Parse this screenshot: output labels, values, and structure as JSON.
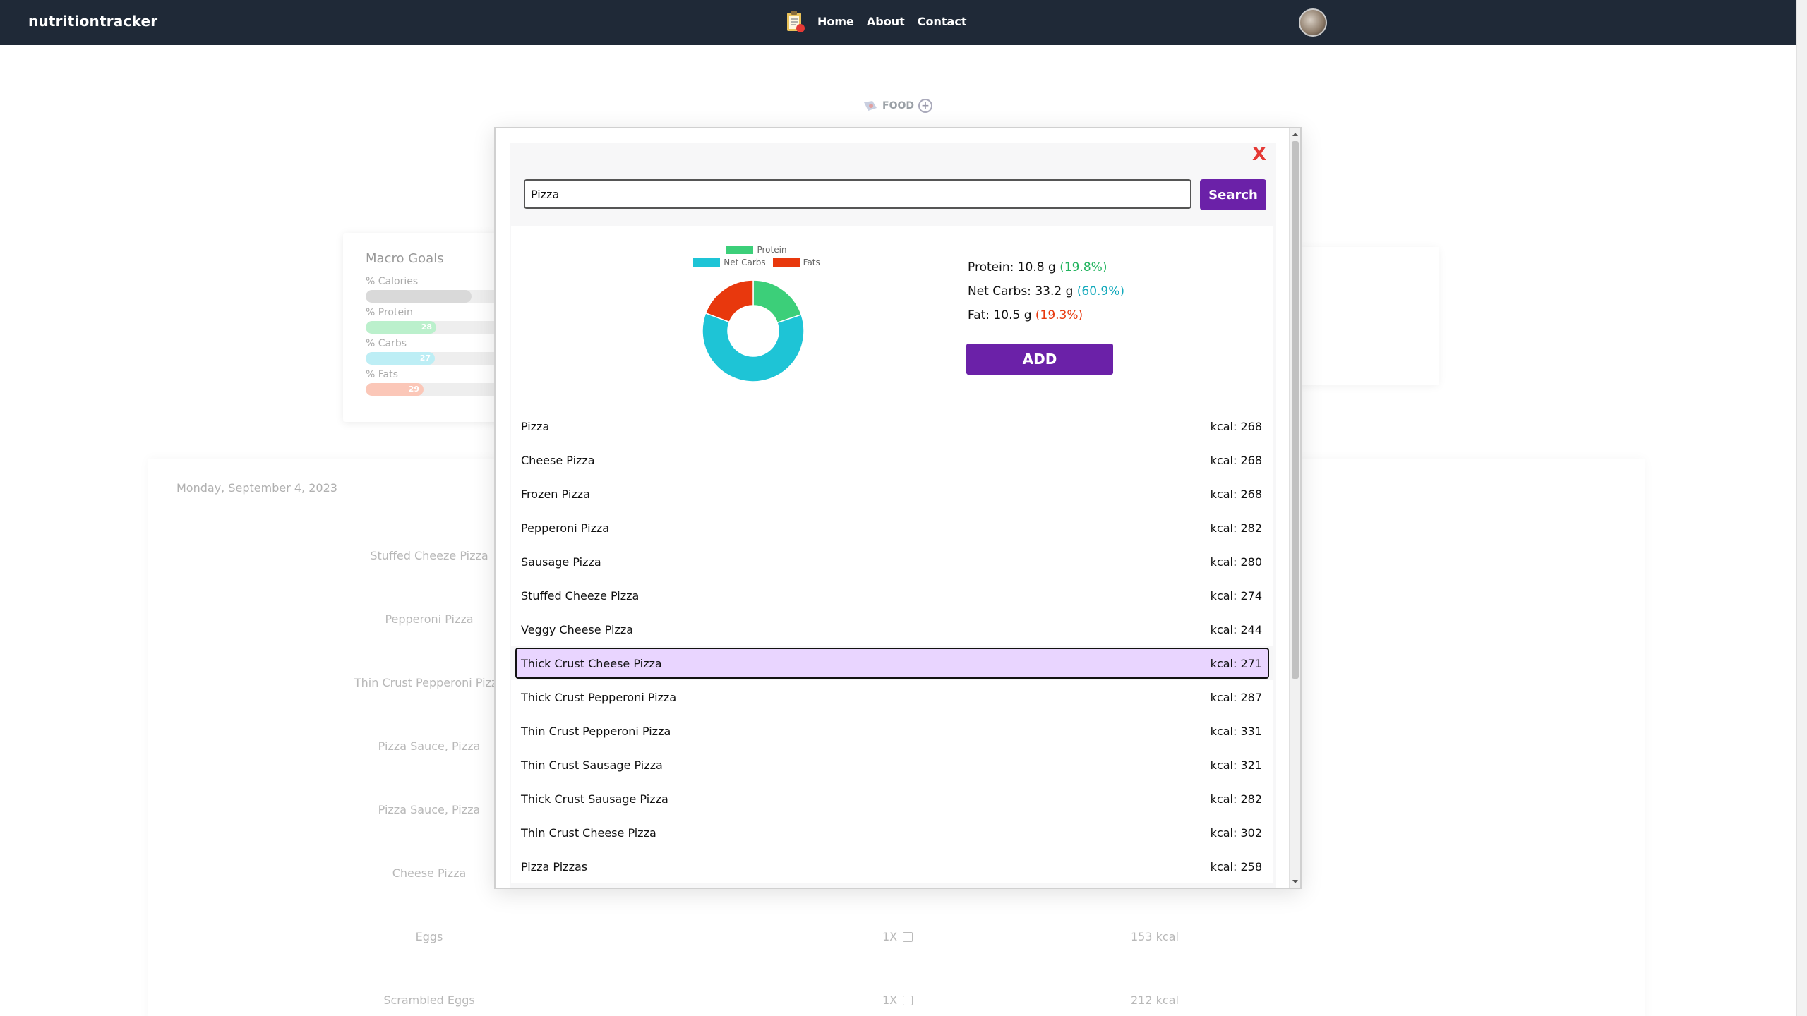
{
  "nav": {
    "brand": "nutritiontracker",
    "links": [
      "Home",
      "About",
      "Contact"
    ]
  },
  "background": {
    "food_header": "FOOD",
    "macro_goals": {
      "title": "Macro Goals",
      "rows": [
        {
          "label": "% Calories",
          "value": "",
          "fill": 0.75,
          "color": "#d9d9d9"
        },
        {
          "label": "% Protein",
          "value": "28",
          "fill": 0.5,
          "color": "#bbf0cc"
        },
        {
          "label": "% Carbs",
          "value": "27",
          "fill": 0.49,
          "color": "#bdeef5"
        },
        {
          "label": "% Fats",
          "value": "29",
          "fill": 0.41,
          "color": "#fbc7b8"
        }
      ]
    },
    "date": "Monday, September 4, 2023",
    "log_items": [
      {
        "name": "Stuffed Cheeze Pizza"
      },
      {
        "name": "Pepperoni Pizza"
      },
      {
        "name": "Thin Crust Pepperoni Pizza"
      },
      {
        "name": "Pizza Sauce, Pizza"
      },
      {
        "name": "Pizza Sauce, Pizza"
      },
      {
        "name": "Cheese Pizza"
      },
      {
        "name": "Eggs",
        "qty": "1X",
        "kcal": "153 kcal"
      },
      {
        "name": "Scrambled Eggs",
        "qty": "1X",
        "kcal": "212 kcal"
      }
    ]
  },
  "modal": {
    "close_label": "X",
    "search": {
      "value": "Pizza",
      "button": "Search"
    },
    "chart_data": {
      "type": "pie",
      "categories": [
        "Protein",
        "Net Carbs",
        "Fats"
      ],
      "values": [
        19.8,
        60.9,
        19.3
      ],
      "colors": [
        "#3ccf79",
        "#1ec4d6",
        "#e8380d"
      ],
      "legend": "top"
    },
    "nutrients": [
      {
        "label": "Protein: ",
        "amount": "10.8 g",
        "pct": "(19.8%)",
        "color": "#22b35e"
      },
      {
        "label": "Net Carbs: ",
        "amount": "33.2 g",
        "pct": "(60.9%)",
        "color": "#12a9bb"
      },
      {
        "label": "Fat: ",
        "amount": "10.5 g",
        "pct": "(19.3%)",
        "color": "#e8380d"
      }
    ],
    "add_label": "ADD",
    "results": [
      {
        "name": "Pizza",
        "kcal": "kcal: 268"
      },
      {
        "name": "Cheese Pizza",
        "kcal": "kcal: 268"
      },
      {
        "name": "Frozen Pizza",
        "kcal": "kcal: 268"
      },
      {
        "name": "Pepperoni Pizza",
        "kcal": "kcal: 282"
      },
      {
        "name": "Sausage Pizza",
        "kcal": "kcal: 280"
      },
      {
        "name": "Stuffed Cheeze Pizza",
        "kcal": "kcal: 274"
      },
      {
        "name": "Veggy Cheese Pizza",
        "kcal": "kcal: 244"
      },
      {
        "name": "Thick Crust Cheese Pizza",
        "kcal": "kcal: 271",
        "selected": true
      },
      {
        "name": "Thick Crust Pepperoni Pizza",
        "kcal": "kcal: 287"
      },
      {
        "name": "Thin Crust Pepperoni Pizza",
        "kcal": "kcal: 331"
      },
      {
        "name": "Thin Crust Sausage Pizza",
        "kcal": "kcal: 321"
      },
      {
        "name": "Thick Crust Sausage Pizza",
        "kcal": "kcal: 282"
      },
      {
        "name": "Thin Crust Cheese Pizza",
        "kcal": "kcal: 302"
      },
      {
        "name": "Pizza Pizzas",
        "kcal": "kcal: 258"
      }
    ]
  }
}
